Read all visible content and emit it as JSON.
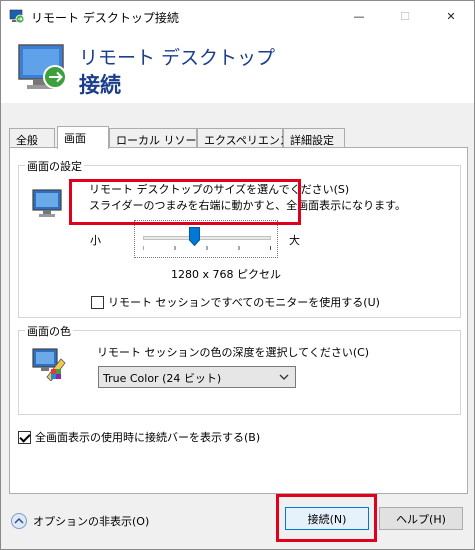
{
  "window": {
    "title": "リモート デスクトップ接続",
    "min_glyph": "—",
    "max_glyph": "☐",
    "close_glyph": "✕",
    "icon": "remote-desktop-icon"
  },
  "banner": {
    "line1": "リモート デスクトップ",
    "line2": "接続",
    "icon": "remote-desktop-banner-icon"
  },
  "tabs": [
    {
      "label": "全般"
    },
    {
      "label": "画面"
    },
    {
      "label": "ローカル リソース"
    },
    {
      "label": "エクスペリエンス"
    },
    {
      "label": "詳細設定"
    }
  ],
  "active_tab": "画面",
  "display_settings": {
    "group_title": "画面の設定",
    "desc_line1": "リモート デスクトップのサイズを選んでください(S)",
    "desc_line2": "スライダーのつまみを右端に動かすと、全画面表示になります。",
    "label_small": "小",
    "label_large": "大",
    "resolution": "1280 x 768 ピクセル",
    "slider_fraction": 0.4,
    "multi_monitor_label": "リモート セッションですべてのモニターを使用する(U)",
    "multi_monitor_checked": false
  },
  "colors_group": {
    "group_title": "画面の色",
    "desc": "リモート セッションの色の深度を選択してください(C)",
    "selected": "True Color (24 ビット)"
  },
  "connection_bar": {
    "label": "全画面表示の使用時に接続バーを表示する(B)",
    "checked": true
  },
  "footer": {
    "options_label": "オプションの非表示(O)",
    "connect_label": "接続(N)",
    "help_label": "ヘルプ(H)"
  },
  "highlight_color": "#e0001b"
}
